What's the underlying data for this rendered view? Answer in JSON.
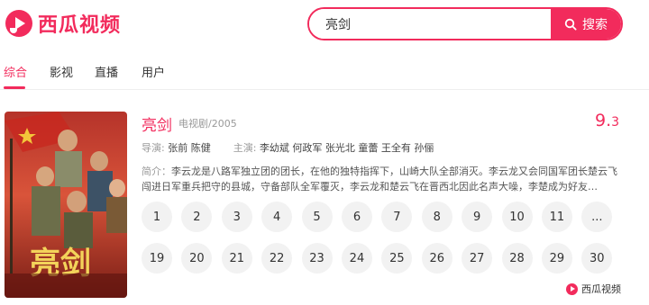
{
  "brand": {
    "name": "西瓜视频",
    "color": "#f22b5c"
  },
  "search": {
    "value": "亮剑",
    "button_label": "搜索",
    "icon": "search-icon"
  },
  "tabs": [
    {
      "label": "综合",
      "active": true
    },
    {
      "label": "影视",
      "active": false
    },
    {
      "label": "直播",
      "active": false
    },
    {
      "label": "用户",
      "active": false
    }
  ],
  "result": {
    "title": "亮剑",
    "meta": "电视剧/2005",
    "score_int": "9.",
    "score_dec": "3",
    "director_label": "导演:",
    "directors": "张前 陈健",
    "cast_label": "主演:",
    "cast": "李幼斌 何政军 张光北 童蕾 王全有 孙俪",
    "synopsis_label": "简介：",
    "synopsis": "李云龙是八路军独立团的团长，在他的独特指挥下，山崎大队全部消灭。李云龙又会同国军团长楚云飞闯进日军重兵把守的县城，守备部队全军覆灭，李云龙和楚云飞在晋西北因此名声大噪，李楚成为好友…",
    "poster_title": "亮剑",
    "episodes": [
      "1",
      "2",
      "3",
      "4",
      "5",
      "6",
      "7",
      "8",
      "9",
      "10",
      "11",
      "...",
      "19",
      "20",
      "21",
      "22",
      "23",
      "24",
      "25",
      "26",
      "27",
      "28",
      "29",
      "30"
    ]
  },
  "watermark": {
    "label": "西瓜视频"
  }
}
